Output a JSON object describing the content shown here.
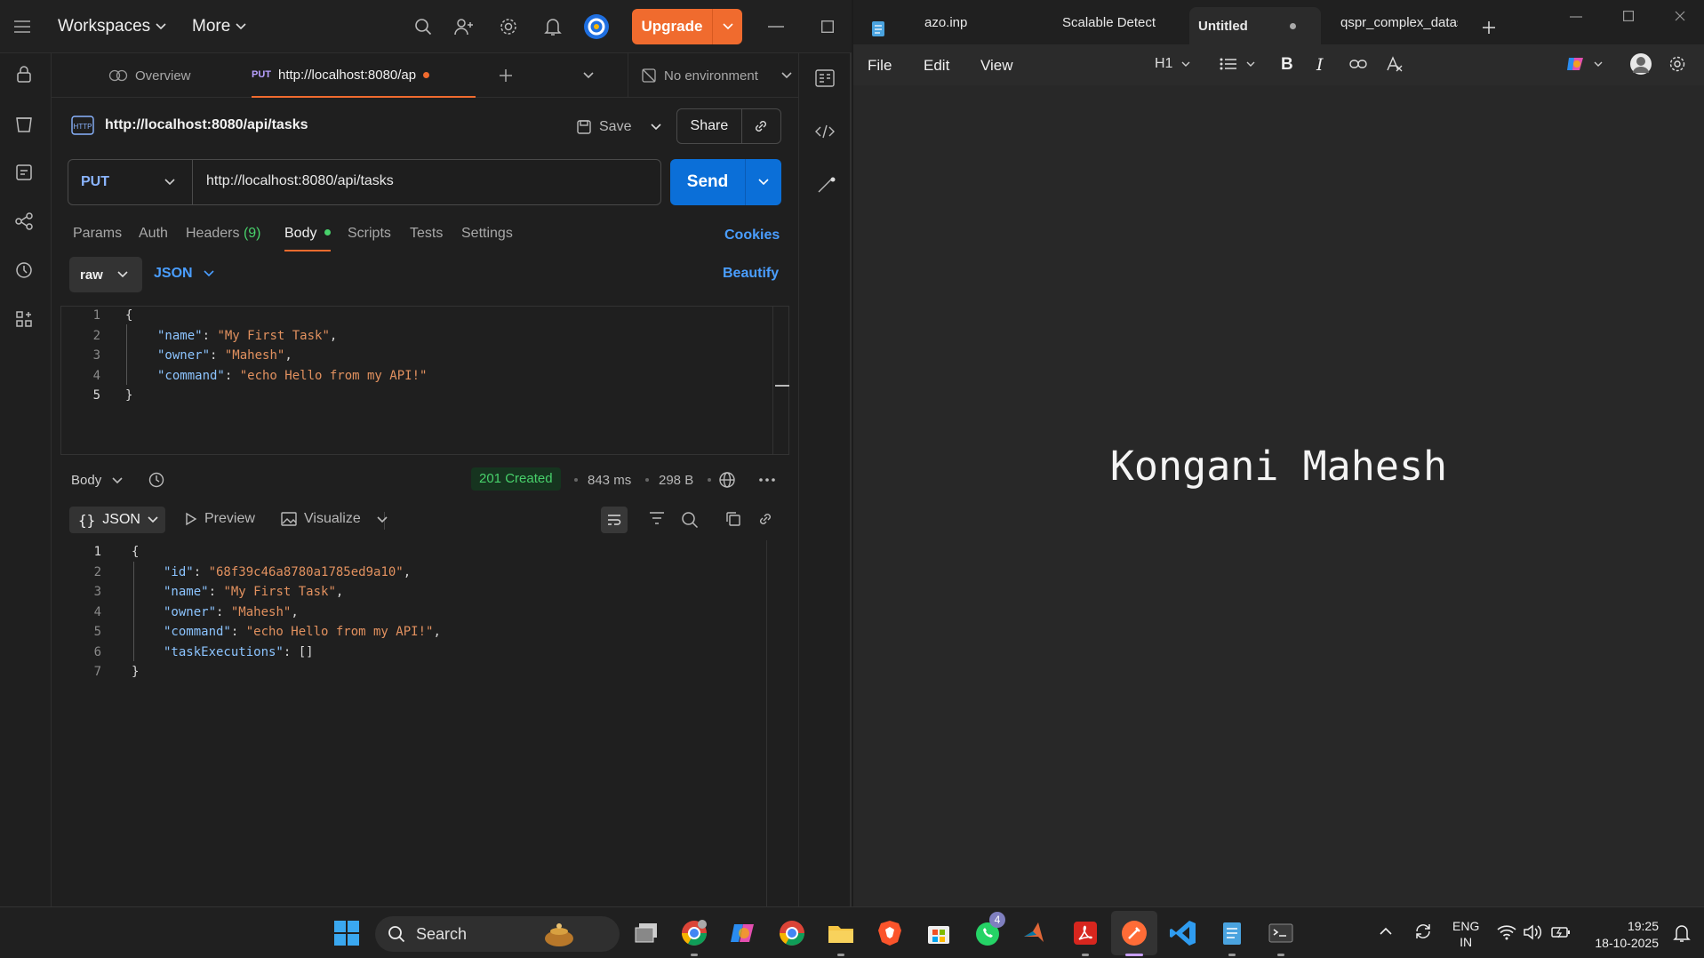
{
  "postman": {
    "topbar": {
      "workspaces": "Workspaces",
      "more": "More",
      "upgrade": "Upgrade"
    },
    "tabs": [
      {
        "label": "Overview"
      },
      {
        "method": "PUT",
        "label": "http://localhost:8080/ap"
      }
    ],
    "environment": "No environment",
    "request": {
      "title": "http://localhost:8080/api/tasks",
      "save_label": "Save",
      "share_label": "Share",
      "method": "PUT",
      "url": "http://localhost:8080/api/tasks",
      "send_label": "Send"
    },
    "request_tabs": {
      "params": "Params",
      "auth": "Auth",
      "headers": "Headers",
      "headers_count": "(9)",
      "body": "Body",
      "scripts": "Scripts",
      "tests": "Tests",
      "settings": "Settings",
      "cookies": "Cookies"
    },
    "body_mode": "raw",
    "body_format": "JSON",
    "beautify": "Beautify",
    "request_body": {
      "line_numbers": [
        "1",
        "2",
        "3",
        "4",
        "5"
      ],
      "name_key": "\"name\"",
      "name_value": "\"My First Task\"",
      "owner_key": "\"owner\"",
      "owner_value": "\"Mahesh\"",
      "command_key": "\"command\"",
      "command_value": "\"echo Hello from my API!\""
    },
    "response": {
      "section_label": "Body",
      "status": "201 Created",
      "time": "843 ms",
      "size": "298 B",
      "format": "JSON",
      "preview": "Preview",
      "visualize": "Visualize",
      "line_numbers": [
        "1",
        "2",
        "3",
        "4",
        "5",
        "6",
        "7"
      ],
      "id_key": "\"id\"",
      "id_value": "\"68f39c46a8780a1785ed9a10\"",
      "name_key": "\"name\"",
      "name_value": "\"My First Task\"",
      "owner_key": "\"owner\"",
      "owner_value": "\"Mahesh\"",
      "command_key": "\"command\"",
      "command_value": "\"echo Hello from my API!\"",
      "exec_key": "\"taskExecutions\"",
      "exec_value": "[]"
    },
    "colors": {
      "accent": "#f06b2e",
      "send": "#0b6fd8",
      "link": "#4a9eff",
      "status_ok": "#48d16b"
    }
  },
  "notepad": {
    "tabs": [
      "azo.inp",
      "Scalable Detection o",
      "Untitled",
      "qspr_complex_datas"
    ],
    "menu": {
      "file": "File",
      "edit": "Edit",
      "view": "View",
      "heading": "H1"
    },
    "content_heading": "Kongani Mahesh"
  },
  "taskbar": {
    "search_label": "Search",
    "whatsapp_badge": "4",
    "language": "ENG",
    "region": "IN",
    "time": "19:25",
    "date": "18-10-2025"
  }
}
